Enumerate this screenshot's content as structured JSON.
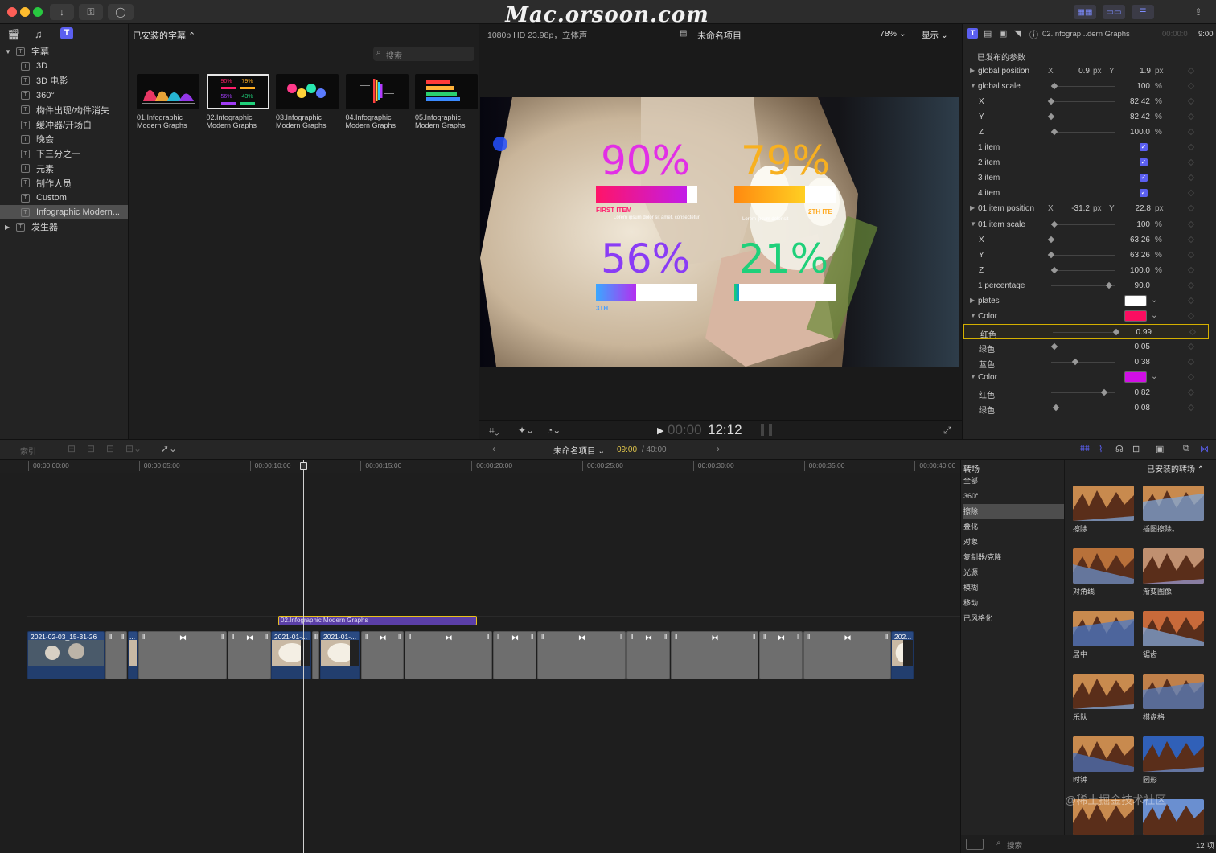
{
  "watermark": "Mac.orsoon.com",
  "library": {
    "items": [
      {
        "label": "字幕",
        "level": 0
      },
      {
        "label": "3D",
        "level": 1
      },
      {
        "label": "3D 电影",
        "level": 1
      },
      {
        "label": "360°",
        "level": 1
      },
      {
        "label": "构件出现/构件消失",
        "level": 1
      },
      {
        "label": "缓冲器/开场白",
        "level": 1
      },
      {
        "label": "晚会",
        "level": 1
      },
      {
        "label": "下三分之一",
        "level": 1
      },
      {
        "label": "元素",
        "level": 1
      },
      {
        "label": "制作人员",
        "level": 1
      },
      {
        "label": "Custom",
        "level": 1
      },
      {
        "label": "Infographic Modern...",
        "level": 1
      },
      {
        "label": "发生器",
        "level": 0
      }
    ],
    "selected_index": 11
  },
  "browser": {
    "dropdown": "已安装的字幕 ⌃",
    "search_placeholder": "搜索",
    "thumbs": [
      {
        "line1": "01.Infographic",
        "line2": "Modern Graphs"
      },
      {
        "line1": "02.Infographic",
        "line2": "Modern Graphs"
      },
      {
        "line1": "03.Infographic",
        "line2": "Modern Graphs"
      },
      {
        "line1": "04.Infographic",
        "line2": "Modern Graphs"
      },
      {
        "line1": "05.Infographic",
        "line2": "Modern Graphs"
      }
    ],
    "selected_index": 1,
    "mini_pct": [
      "90%",
      "79%",
      "56%",
      "43%"
    ]
  },
  "viewer": {
    "format": "1080p HD 23.98p，立体声",
    "project": "未命名项目",
    "zoom": "78% ⌄",
    "display": "显示 ⌄",
    "timecode_dim": "00:00",
    "timecode": "12:12",
    "overlay": {
      "pct1": "90%",
      "pct2": "79%",
      "pct3": "56%",
      "pct4": "21%",
      "label1": "FIRST ITEM",
      "label2": "2TH ITE",
      "label3": "3TH",
      "sub1": "Lorem ipsum dolor sit amet, consectetur",
      "sub2": "Lorem ipsum dolor sit"
    },
    "bars": [
      0.9,
      0.7,
      0.4,
      0.05
    ]
  },
  "inspector": {
    "title": "02.Infograp...dern Graphs",
    "duration_dim": "00:00:0",
    "duration": "9:00",
    "section": "已发布的参数",
    "rows": [
      {
        "label": "global position",
        "tri": "▶",
        "x": "0.9",
        "y": "1.9",
        "unit": "px",
        "xy": true
      },
      {
        "label": "global scale",
        "tri": "▼",
        "value": "100",
        "unit": "%",
        "slider": 0.05
      },
      {
        "label": "X",
        "sub": true,
        "value": "82.42",
        "unit": "%",
        "slider": 0.0
      },
      {
        "label": "Y",
        "sub": true,
        "value": "82.42",
        "unit": "%",
        "slider": 0.0
      },
      {
        "label": "Z",
        "sub": true,
        "value": "100.0",
        "unit": "%",
        "slider": 0.05
      },
      {
        "label": "1 item",
        "check": true
      },
      {
        "label": "2 item",
        "check": true
      },
      {
        "label": "3 item",
        "check": true
      },
      {
        "label": "4 item",
        "check": true
      },
      {
        "label": "01.item position",
        "tri": "▶",
        "x": "-31.2",
        "y": "22.8",
        "unit": "px",
        "xy": true
      },
      {
        "label": "01.item scale",
        "tri": "▼",
        "value": "100",
        "unit": "%",
        "slider": 0.05
      },
      {
        "label": "X",
        "sub": true,
        "value": "63.26",
        "unit": "%",
        "slider": 0.0
      },
      {
        "label": "Y",
        "sub": true,
        "value": "63.26",
        "unit": "%",
        "slider": 0.0
      },
      {
        "label": "Z",
        "sub": true,
        "value": "100.0",
        "unit": "%",
        "slider": 0.05
      },
      {
        "label": "1 percentage",
        "value": "90.0",
        "slider": 0.9
      },
      {
        "label": "plates",
        "tri": "▶",
        "swatch": "#ffffff"
      },
      {
        "label": "Color",
        "tri": "▼",
        "swatch": "#fb0d61"
      },
      {
        "label": "红色",
        "sub": true,
        "value": "0.99",
        "slider": 0.99,
        "highlight": true
      },
      {
        "label": "绿色",
        "sub": true,
        "value": "0.05",
        "slider": 0.05
      },
      {
        "label": "蓝色",
        "sub": true,
        "value": "0.38",
        "slider": 0.38
      },
      {
        "label": "Color",
        "tri": "▼",
        "swatch": "#d10fe6"
      },
      {
        "label": "红色",
        "sub": true,
        "value": "0.82",
        "slider": 0.82
      },
      {
        "label": "绿色",
        "sub": true,
        "value": "0.08",
        "slider": 0.08
      }
    ]
  },
  "timeline": {
    "index_label": "索引",
    "project": "未命名项目 ⌄",
    "position": "09:00",
    "duration": "/ 40:00",
    "ruler": [
      "00:00:00:00",
      "00:00:05:00",
      "00:00:10:00",
      "00:00:15:00",
      "00:00:20:00",
      "00:00:25:00",
      "00:00:30:00",
      "00:00:35:00",
      "00:00:40:00"
    ],
    "title_clip": "02.Infographic Modern Graphs",
    "video_clips": [
      "2021-02-03_15-31-26",
      "2021-01-...",
      "2021-01-...",
      "202..."
    ],
    "ellipsis": "..."
  },
  "transitions": {
    "header": "转场",
    "dropdown": "已安装的转场 ⌃",
    "categories": [
      "全部",
      "360°",
      "擦除",
      "叠化",
      "对象",
      "复制器/克隆",
      "光源",
      "模糊",
      "移动",
      "已风格化"
    ],
    "selected_category": 2,
    "items": [
      "擦除",
      "插图擦除。",
      "对角线",
      "渐变图像",
      "居中",
      "锯齿",
      "乐队",
      "棋盘格",
      "时钟",
      "圆形"
    ],
    "search_placeholder": "搜索",
    "count": "12 项",
    "corner_watermark": "@稀土掘金技术社区"
  },
  "colors": {
    "accent": "#5b5ff0",
    "title_clip": "#5b3fa8",
    "video_clip": "#2a4a82",
    "highlight": "#d4b000"
  }
}
